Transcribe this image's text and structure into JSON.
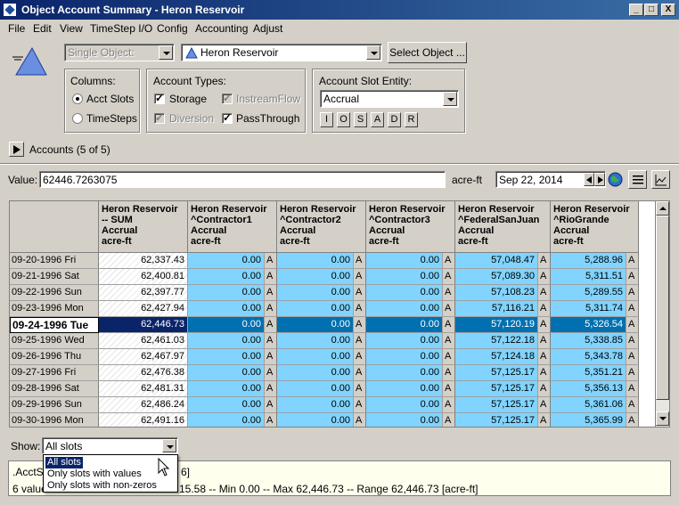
{
  "window": {
    "title": "Object Account Summary - Heron Reservoir",
    "minimize": "_",
    "maximize": "□",
    "close": "X"
  },
  "menu": [
    "File",
    "Edit",
    "View",
    "TimeStep I/O",
    "Config",
    "Accounting",
    "Adjust"
  ],
  "object_selector": {
    "mode_value": "Single Object:",
    "object_value": "Heron Reservoir",
    "select_button": "Select Object ..."
  },
  "columns_group": {
    "title": "Columns:",
    "options": [
      "Acct Slots",
      "TimeSteps"
    ],
    "selected": "Acct Slots"
  },
  "account_types": {
    "title": "Account Types:",
    "items": [
      {
        "label": "Storage",
        "checked": true,
        "enabled": true
      },
      {
        "label": "InstreamFlow",
        "checked": true,
        "enabled": false
      },
      {
        "label": "Diversion",
        "checked": true,
        "enabled": false
      },
      {
        "label": "PassThrough",
        "checked": true,
        "enabled": true
      }
    ]
  },
  "slot_entity": {
    "title": "Account Slot Entity:",
    "value": "Accrual",
    "buttons": [
      "I",
      "O",
      "S",
      "A",
      "D",
      "R"
    ]
  },
  "accounts_toggle": {
    "label": "Accounts  (5 of 5)"
  },
  "value_row": {
    "label": "Value:",
    "value": "62446.7263075",
    "unit": "acre-ft",
    "date": "Sep 22, 2014"
  },
  "table": {
    "columns": [
      {
        "lines": [
          "Heron Reservoir",
          "-- SUM",
          "Accrual",
          "acre-ft"
        ]
      },
      {
        "lines": [
          "Heron Reservoir",
          "^Contractor1",
          "Accrual",
          "acre-ft"
        ]
      },
      {
        "lines": [
          "Heron Reservoir",
          "^Contractor2",
          "Accrual",
          "acre-ft"
        ]
      },
      {
        "lines": [
          "Heron Reservoir",
          "^Contractor3",
          "Accrual",
          "acre-ft"
        ]
      },
      {
        "lines": [
          "Heron Reservoir",
          "^FederalSanJuan",
          "Accrual",
          "acre-ft"
        ]
      },
      {
        "lines": [
          "Heron Reservoir",
          "^RioGrande",
          "Accrual",
          "acre-ft"
        ]
      }
    ],
    "flag": "A",
    "selected_row": 4,
    "rows": [
      {
        "date": "09-20-1996 Fri",
        "values": [
          "62,337.43",
          "0.00",
          "0.00",
          "0.00",
          "57,048.47",
          "5,288.96"
        ]
      },
      {
        "date": "09-21-1996 Sat",
        "values": [
          "62,400.81",
          "0.00",
          "0.00",
          "0.00",
          "57,089.30",
          "5,311.51"
        ]
      },
      {
        "date": "09-22-1996 Sun",
        "values": [
          "62,397.77",
          "0.00",
          "0.00",
          "0.00",
          "57,108.23",
          "5,289.55"
        ]
      },
      {
        "date": "09-23-1996 Mon",
        "values": [
          "62,427.94",
          "0.00",
          "0.00",
          "0.00",
          "57,116.21",
          "5,311.74"
        ]
      },
      {
        "date": "09-24-1996 Tue",
        "values": [
          "62,446.73",
          "0.00",
          "0.00",
          "0.00",
          "57,120.19",
          "5,326.54"
        ]
      },
      {
        "date": "09-25-1996 Wed",
        "values": [
          "62,461.03",
          "0.00",
          "0.00",
          "0.00",
          "57,122.18",
          "5,338.85"
        ]
      },
      {
        "date": "09-26-1996 Thu",
        "values": [
          "62,467.97",
          "0.00",
          "0.00",
          "0.00",
          "57,124.18",
          "5,343.78"
        ]
      },
      {
        "date": "09-27-1996 Fri",
        "values": [
          "62,476.38",
          "0.00",
          "0.00",
          "0.00",
          "57,125.17",
          "5,351.21"
        ]
      },
      {
        "date": "09-28-1996 Sat",
        "values": [
          "62,481.31",
          "0.00",
          "0.00",
          "0.00",
          "57,125.17",
          "5,356.13"
        ]
      },
      {
        "date": "09-29-1996 Sun",
        "values": [
          "62,486.24",
          "0.00",
          "0.00",
          "0.00",
          "57,125.17",
          "5,361.06"
        ]
      },
      {
        "date": "09-30-1996 Mon",
        "values": [
          "62,491.16",
          "0.00",
          "0.00",
          "0.00",
          "57,125.17",
          "5,365.99"
        ]
      }
    ]
  },
  "show": {
    "label": "Show:",
    "value": "All slots",
    "options": [
      "All slots",
      "Only slots with values",
      "Only slots with non-zeros"
    ],
    "highlighted": 0
  },
  "status": {
    "line1_start": ".AcctS",
    "line1_end": "6]",
    "line2_start": "6 value",
    "line2_end": "15.58 -- Min 0.00 -- Max 62,446.73 -- Range 62,446.73 [acre-ft]"
  },
  "colors": {
    "title_bar": "#0a246a",
    "cell_blue": "#80d4ff",
    "row_selected": "#0070b0",
    "sum_selected": "#0a246a"
  }
}
